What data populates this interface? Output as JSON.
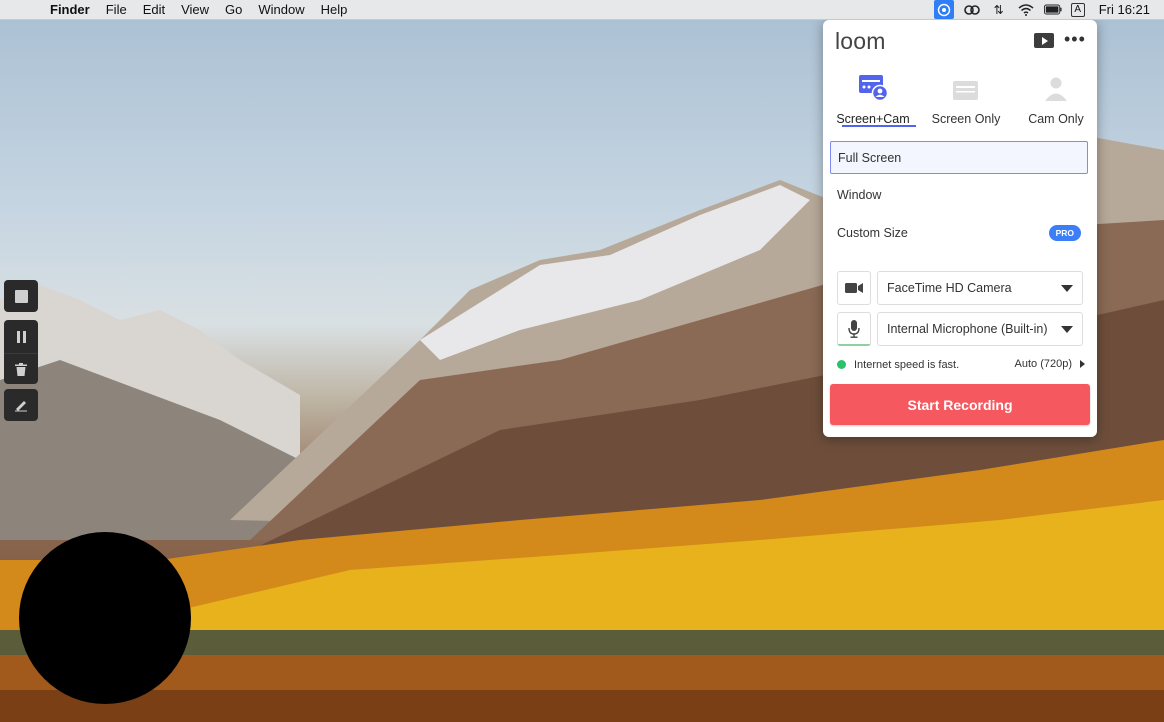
{
  "menubar": {
    "app_name": "Finder",
    "items": [
      "File",
      "Edit",
      "View",
      "Go",
      "Window",
      "Help"
    ],
    "input_source": "A",
    "clock": "Fri 16:21"
  },
  "loom": {
    "logo": "loom",
    "modes": [
      {
        "label": "Screen+Cam",
        "icon": "screen-cam-icon",
        "selected": true
      },
      {
        "label": "Screen Only",
        "icon": "screen-only-icon",
        "selected": false
      },
      {
        "label": "Cam Only",
        "icon": "cam-only-icon",
        "selected": false
      }
    ],
    "options": {
      "full_screen": "Full Screen",
      "window": "Window",
      "custom_size": "Custom Size",
      "pro_badge": "PRO"
    },
    "camera": "FaceTime HD Camera",
    "microphone": "Internal Microphone (Built-in)",
    "status_text": "Internet speed is fast.",
    "quality": "Auto (720p)",
    "start_button": "Start Recording",
    "colors": {
      "accent": "#5264ee",
      "start": "#f5585e",
      "pro": "#3c7ef7",
      "status_ok": "#29c26a"
    }
  }
}
